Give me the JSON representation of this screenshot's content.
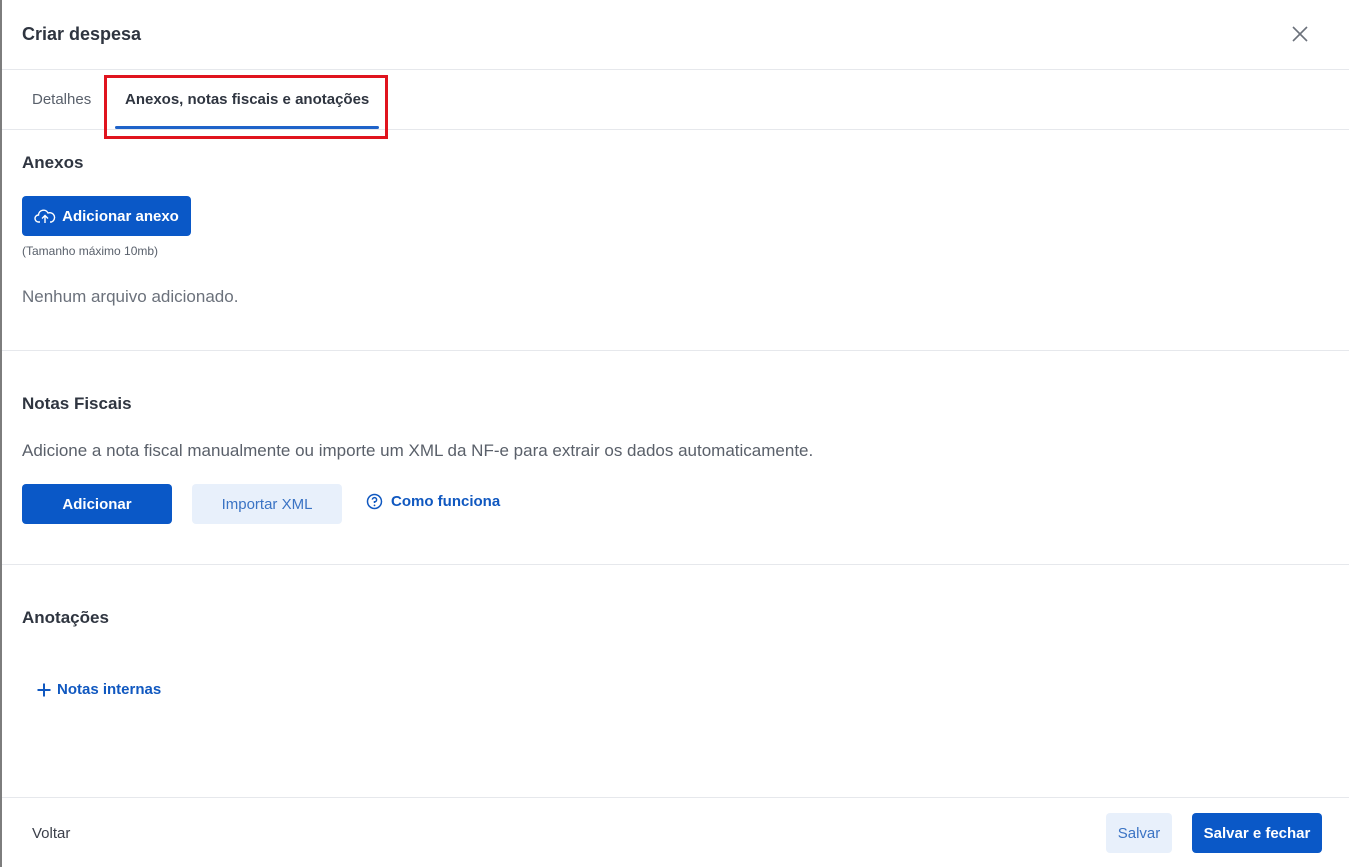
{
  "modal": {
    "title": "Criar despesa"
  },
  "tabs": [
    {
      "label": "Detalhes",
      "active": false
    },
    {
      "label": "Anexos, notas fiscais e anotações",
      "active": true
    }
  ],
  "anexos": {
    "title": "Anexos",
    "add_button": "Adicionar anexo",
    "size_note": "(Tamanho máximo 10mb)",
    "empty_text": "Nenhum arquivo adicionado."
  },
  "notas": {
    "title": "Notas Fiscais",
    "description": "Adicione a nota fiscal manualmente ou importe um XML da NF-e para extrair os dados automaticamente.",
    "add_button": "Adicionar",
    "import_button": "Importar XML",
    "help_link": "Como funciona"
  },
  "anotacoes": {
    "title": "Anotações",
    "internal_notes_link": "Notas internas"
  },
  "footer": {
    "back": "Voltar",
    "save": "Salvar",
    "save_close": "Salvar e fechar"
  },
  "colors": {
    "primary": "#0a58c7",
    "secondary_bg": "#e8f0fb",
    "highlight": "#e0141e"
  },
  "icons": {
    "close": "close-icon",
    "upload": "cloud-upload-icon",
    "help": "help-circle-icon",
    "plus": "plus-icon"
  }
}
